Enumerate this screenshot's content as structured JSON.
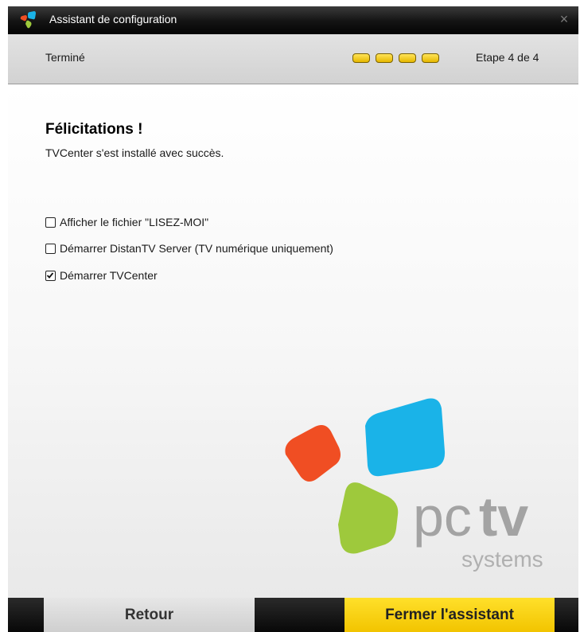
{
  "window": {
    "title": "Assistant de configuration",
    "close_icon": "×"
  },
  "step": {
    "name": "Terminé",
    "progress": "Etape 4 de 4",
    "completed_steps": 4,
    "total_steps": 4
  },
  "content": {
    "heading": "Félicitations !",
    "subtext": "TVCenter s'est installé avec succès.",
    "options": [
      {
        "label": "Afficher le fichier \"LISEZ-MOI\"",
        "checked": false
      },
      {
        "label": "Démarrer DistanTV Server (TV numérique uniquement)",
        "checked": false
      },
      {
        "label": "Démarrer TVCenter",
        "checked": true
      }
    ]
  },
  "logo": {
    "wordmark_light": "pc",
    "wordmark_bold": "tv",
    "tagline": "systems",
    "colors": {
      "red": "#f04e23",
      "blue": "#1ab3e8",
      "green": "#9ec93c",
      "text": "#a3a3a3"
    }
  },
  "footer": {
    "back_label": "Retour",
    "close_label": "Fermer l'assistant"
  },
  "colors": {
    "accent_yellow": "#f5cc00",
    "titlebar": "#141414"
  }
}
